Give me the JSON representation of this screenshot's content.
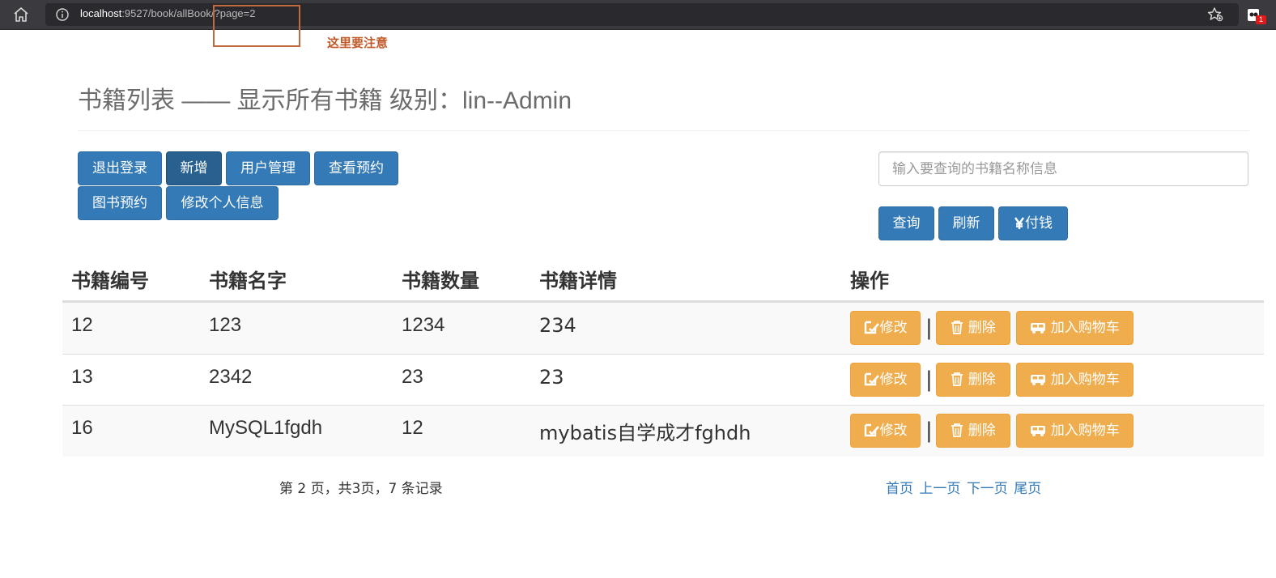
{
  "browser": {
    "url_host": "localhost",
    "url_rest": ":9527/book/allBook/?page=2",
    "badge_count": "1"
  },
  "annotation": {
    "text": "这里要注意"
  },
  "header": {
    "title": "书籍列表 —— 显示所有书籍 级别：lin--Admin"
  },
  "toolbar": {
    "logout": "退出登录",
    "add": "新增",
    "user_manage": "用户管理",
    "view_reserve": "查看预约",
    "book_reserve": "图书预约",
    "edit_profile": "修改个人信息"
  },
  "search": {
    "placeholder": "输入要查询的书籍名称信息",
    "query_label": "查询",
    "refresh_label": "刷新",
    "pay_label": "付钱"
  },
  "table": {
    "headers": [
      "书籍编号",
      "书籍名字",
      "书籍数量",
      "书籍详情",
      "操作"
    ],
    "rows": [
      {
        "id": "12",
        "name": "123",
        "count": "1234",
        "detail": "234"
      },
      {
        "id": "13",
        "name": "2342",
        "count": "23",
        "detail": "23"
      },
      {
        "id": "16",
        "name": "MySQL1fgdh",
        "count": "12",
        "detail": "mybatis自学成才fghdh"
      }
    ],
    "actions": {
      "edit": "修改",
      "delete": "删除",
      "cart": "加入购物车",
      "separator": "|"
    }
  },
  "pagination": {
    "summary": "第 2 页，共3页，7 条记录",
    "first": "首页",
    "prev": "上一页",
    "next": "下一页",
    "last": "尾页"
  },
  "colors": {
    "primary": "#337ab7",
    "primary_active": "#286090",
    "warning": "#f0ad4e",
    "annotation": "#c05a2a"
  }
}
